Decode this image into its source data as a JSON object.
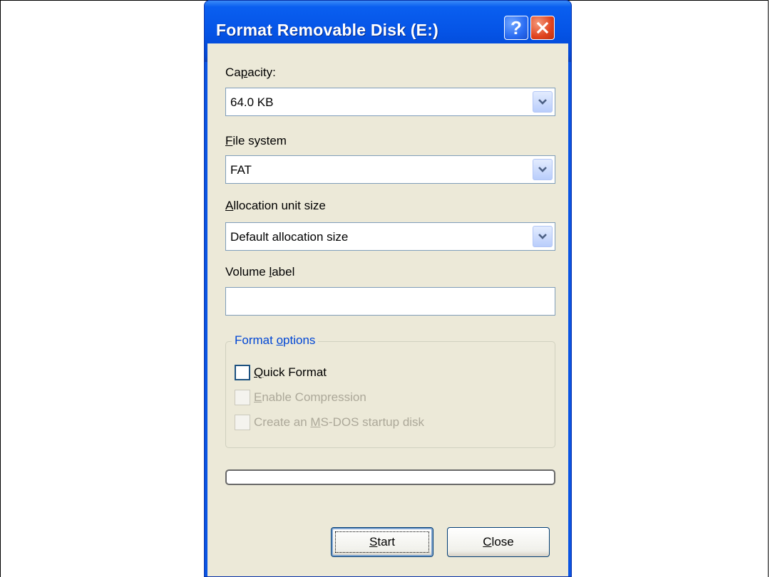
{
  "window": {
    "title": "Format Removable Disk (E:)",
    "help_symbol": "?"
  },
  "fields": {
    "capacity": {
      "label_pre": "Ca",
      "label_key": "p",
      "label_post": "acity:",
      "value": "64.0 KB"
    },
    "file_system": {
      "label_pre": "",
      "label_key": "F",
      "label_post": "ile system",
      "value": "FAT"
    },
    "allocation": {
      "label_pre": "",
      "label_key": "A",
      "label_post": "llocation unit size",
      "value": "Default allocation size"
    },
    "volume_label": {
      "label_pre": "Volume ",
      "label_key": "l",
      "label_post": "abel",
      "value": ""
    }
  },
  "format_options": {
    "title_pre": "Format ",
    "title_key": "o",
    "title_post": "ptions",
    "quick": {
      "key": "Q",
      "rest": "uick Format",
      "checked": false,
      "enabled": true
    },
    "compression": {
      "key": "E",
      "rest": "nable Compression",
      "checked": false,
      "enabled": false
    },
    "msdos": {
      "pre": "Create an ",
      "key": "M",
      "rest": "S-DOS startup disk",
      "checked": false,
      "enabled": false
    }
  },
  "progress": {
    "fraction": 0
  },
  "buttons": {
    "start": {
      "key": "S",
      "rest": "tart"
    },
    "close": {
      "key": "C",
      "rest": "lose"
    }
  },
  "colors": {
    "titlebar": "#0554e6",
    "dialog_bg": "#ece9d8",
    "group_title": "#0046d5",
    "close_button": "#e0431e",
    "disabled_text": "#aca899"
  },
  "icons": {
    "help": "help-icon",
    "close": "close-icon",
    "dropdown": "chevron-down-icon"
  }
}
